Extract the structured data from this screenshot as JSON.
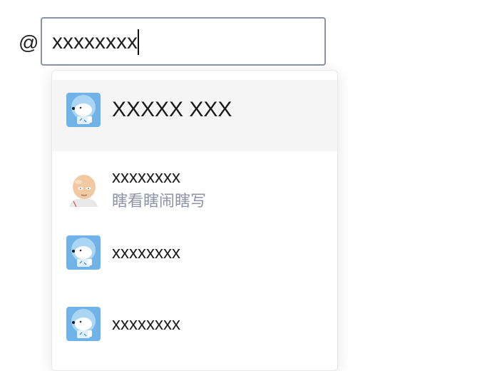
{
  "mention": {
    "trigger": "@",
    "input_value": "xxxxxxxx"
  },
  "suggestions": [
    {
      "name": "XXXXX XXX",
      "subtitle": "",
      "avatar": "robot-dog-avatar",
      "active": true
    },
    {
      "name": "xxxxxxxx",
      "subtitle": "瞎看瞎闹瞎写",
      "avatar": "bald-man-avatar",
      "active": false
    },
    {
      "name": "xxxxxxxx",
      "subtitle": "",
      "avatar": "robot-dog-avatar",
      "active": false
    },
    {
      "name": "xxxxxxxx",
      "subtitle": "",
      "avatar": "robot-dog-avatar",
      "active": false
    }
  ],
  "colors": {
    "input_border": "#8a94a6",
    "active_row_bg": "#f5f5f5",
    "subtitle_text": "#8b93a7",
    "avatar_blue": "#6fb3e8"
  }
}
